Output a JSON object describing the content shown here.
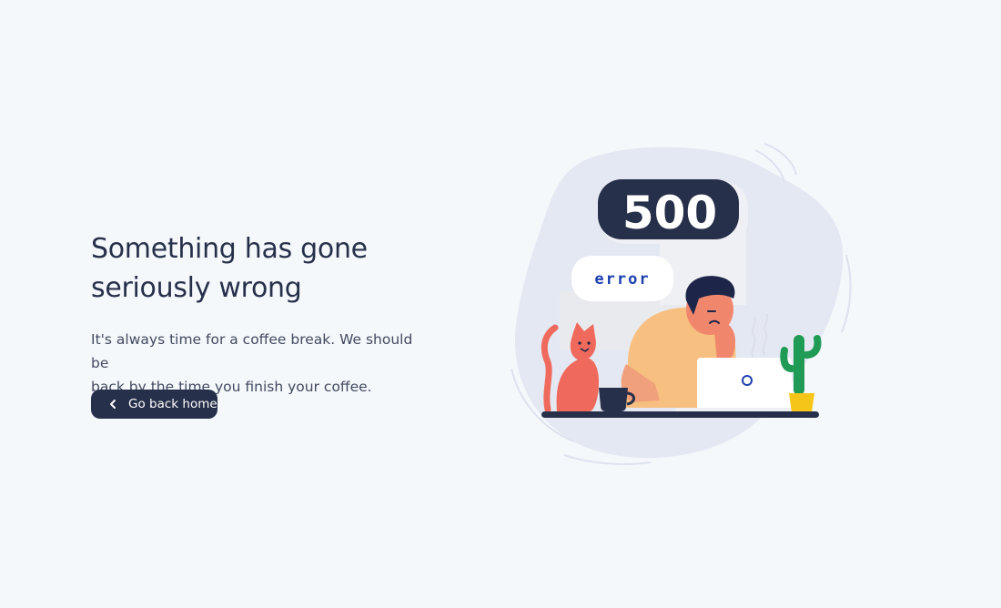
{
  "error_page": {
    "headline_line1": "Something has gone",
    "headline_line2": "seriously wrong",
    "message_line1": "It's always time for a coffee break. We should be",
    "message_line2": "back by the time you finish your coffee.",
    "home_button_label": "Go back home",
    "home_button_icon": "chevron-left-icon"
  },
  "illustration": {
    "status_code": "500",
    "status_word": "error",
    "objects": [
      "person-at-laptop",
      "cat",
      "coffee-cup",
      "cactus-in-pot",
      "desk"
    ]
  },
  "colors": {
    "page_background": "#f5f8fb",
    "headline_text": "#27304a",
    "body_text": "#424a5f",
    "button_background": "#27304a",
    "button_text": "#ffffff",
    "blob": "#e4e8f3",
    "error_word": "#1e40af",
    "cat": "#ef6a5c",
    "shirt": "#f7bf80",
    "cactus": "#1f9b55",
    "pot": "#f5c518"
  }
}
